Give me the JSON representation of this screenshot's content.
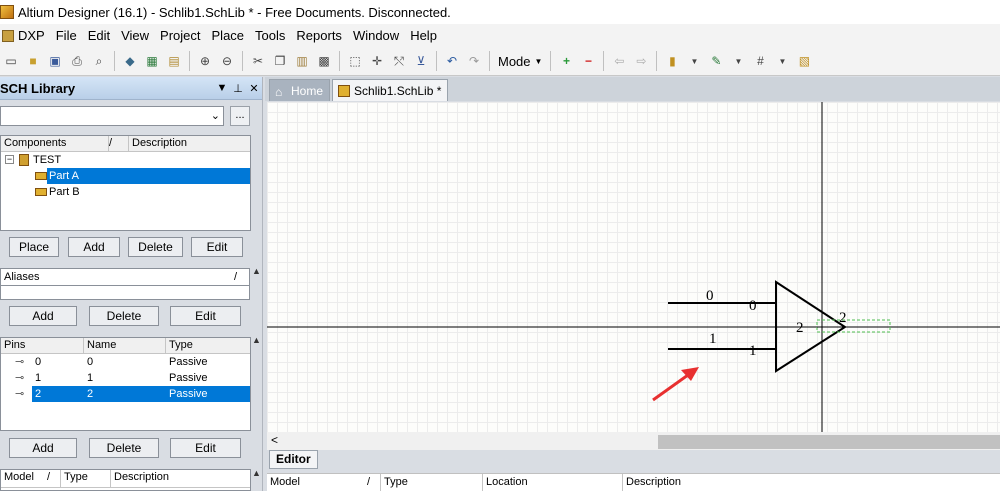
{
  "window": {
    "title": "Altium Designer (16.1) - Schlib1.SchLib * - Free Documents. Disconnected."
  },
  "menu": [
    "DXP",
    "File",
    "Edit",
    "View",
    "Project",
    "Place",
    "Tools",
    "Reports",
    "Window",
    "Help"
  ],
  "toolbar": {
    "mode_label": "Mode"
  },
  "panel": {
    "title": "SCH Library",
    "combo_more": "...",
    "components_header": {
      "col1": "Components",
      "sort": "/",
      "col2": "Description"
    },
    "tree": {
      "root": "TEST",
      "parts": [
        "Part A",
        "Part B"
      ]
    },
    "buttons1": [
      "Place",
      "Add",
      "Delete",
      "Edit"
    ],
    "aliases_label": "Aliases",
    "aliases_sort": "/",
    "buttons2": [
      "Add",
      "Delete",
      "Edit"
    ],
    "pins_header": {
      "col1": "Pins",
      "col2": "Name",
      "col3": "Type"
    },
    "pins": [
      {
        "pin": "0",
        "name": "0",
        "type": "Passive"
      },
      {
        "pin": "1",
        "name": "1",
        "type": "Passive"
      },
      {
        "pin": "2",
        "name": "2",
        "type": "Passive"
      }
    ],
    "buttons3": [
      "Add",
      "Delete",
      "Edit"
    ],
    "model_header": {
      "col1": "Model",
      "sort": "/",
      "col2": "Type",
      "col3": "Description"
    }
  },
  "tabs": {
    "home": "Home",
    "doc": "Schlib1.SchLib *"
  },
  "schematic": {
    "pin0_name": "0",
    "pin0_num": "0",
    "pin1_name": "1",
    "pin1_num": "1",
    "pin2_name": "2",
    "pin2_num": "2"
  },
  "editor": {
    "tab": "Editor",
    "columns": {
      "model": "Model",
      "sort": "/",
      "type": "Type",
      "location": "Location",
      "description": "Description"
    }
  }
}
